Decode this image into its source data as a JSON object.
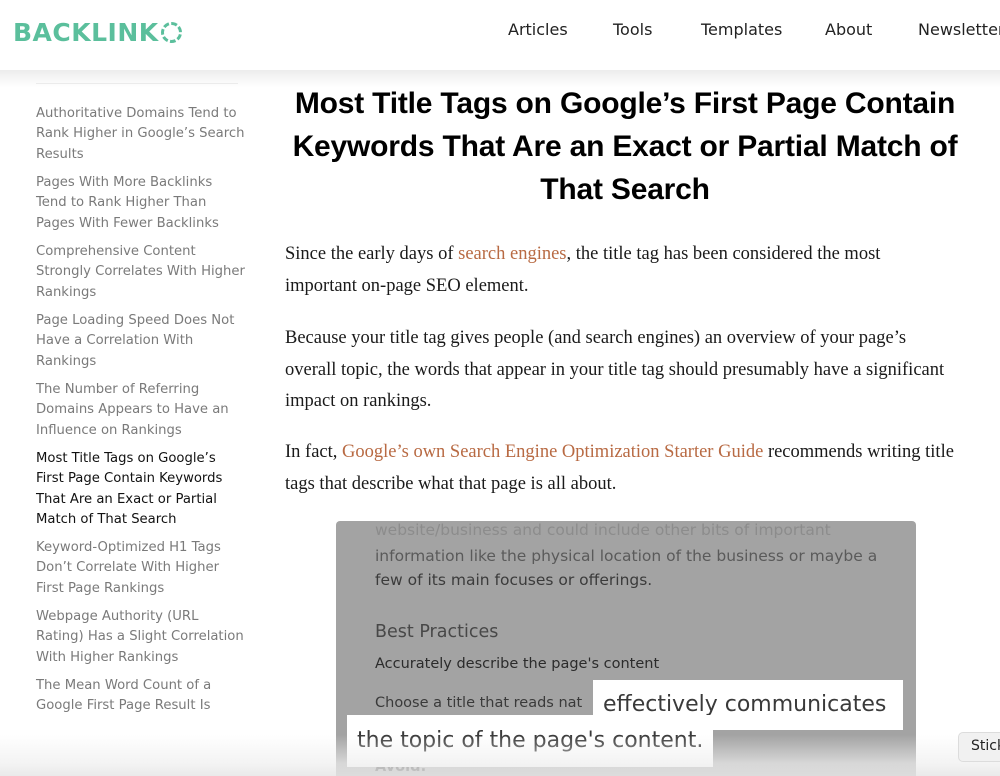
{
  "header": {
    "logo_text": "BACKLINK",
    "logo_icon": "ring-o-icon",
    "brand_color": "#5bbf9c",
    "nav": [
      {
        "label": "Articles"
      },
      {
        "label": "Tools"
      },
      {
        "label": "Templates"
      },
      {
        "label": "About"
      },
      {
        "label": "Newsletter"
      }
    ]
  },
  "sidebar": {
    "items": [
      {
        "label": "Authoritative Domains Tend to Rank Higher in Google’s Search Results",
        "active": false
      },
      {
        "label": "Pages With More Backlinks Tend to Rank Higher Than Pages With Fewer Backlinks",
        "active": false
      },
      {
        "label": "Comprehensive Content Strongly Correlates With Higher Rankings",
        "active": false
      },
      {
        "label": "Page Loading Speed Does Not Have a Correlation With Rankings",
        "active": false
      },
      {
        "label": "The Number of Referring Domains Appears to Have an Influence on Rankings",
        "active": false
      },
      {
        "label": "Most Title Tags on Google’s First Page Contain Keywords That Are an Exact or Partial Match of That Search",
        "active": true
      },
      {
        "label": "Keyword-Optimized H1 Tags Don’t Correlate With Higher First Page Rankings",
        "active": false
      },
      {
        "label": "Webpage Authority (URL Rating) Has a Slight Correlation With Higher Rankings",
        "active": false
      },
      {
        "label": "The Mean Word Count of a Google First Page Result Is",
        "active": false
      }
    ]
  },
  "article": {
    "title": "Most Title Tags on Google’s First Page Contain Keywords That Are an Exact or Partial Match of That Search",
    "paragraphs": [
      {
        "before": "Since the early days of ",
        "link": "search engines",
        "after": ", the title tag has been considered the most important on-page SEO element."
      },
      {
        "text": "Because your title tag gives people (and search engines) an overview of your page’s overall topic, the words that appear in your title tag should presumably have a significant impact on rankings."
      },
      {
        "before": "In fact, ",
        "link": "Google’s own Search Engine Optimization Starter Guide",
        "after": " recommends writing title tags that describe what that page is all about."
      }
    ],
    "link_color": "#b86a43"
  },
  "guide_image": {
    "faded_line": "website/business and could include other bits of important",
    "line2": "information like the physical location of the business or maybe a",
    "line3": "few of its main focuses or offerings.",
    "heading": "Best Practices",
    "subheading": "Accurately describe the page's content",
    "body": "Choose a title that reads nat",
    "avoid": "Avoid:",
    "callout_1": "effectively communicates",
    "callout_2": "the topic of the page's content."
  },
  "sticky_tab": {
    "label": "Sticky"
  }
}
